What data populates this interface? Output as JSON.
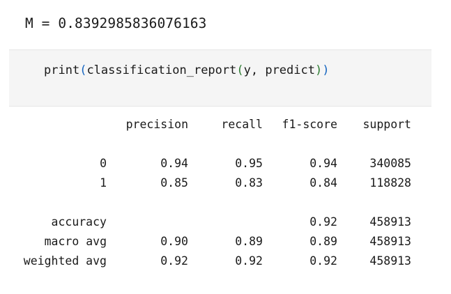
{
  "output": {
    "text": "M = 0.8392985836076163"
  },
  "code_cell": {
    "func": "print",
    "open1": "(",
    "inner_func": "classification_report",
    "open2": "(",
    "args": "y, predict",
    "close2": ")",
    "close1": ")"
  },
  "report": {
    "headers": {
      "precision": "precision",
      "recall": "recall",
      "f1": "f1-score",
      "support": "support"
    },
    "rows": [
      {
        "label": "0",
        "precision": "0.94",
        "recall": "0.95",
        "f1": "0.94",
        "support": "340085"
      },
      {
        "label": "1",
        "precision": "0.85",
        "recall": "0.83",
        "f1": "0.84",
        "support": "118828"
      },
      {
        "label": "accuracy",
        "precision": "",
        "recall": "",
        "f1": "0.92",
        "support": "458913"
      },
      {
        "label": "macro avg",
        "precision": "0.90",
        "recall": "0.89",
        "f1": "0.89",
        "support": "458913"
      },
      {
        "label": "weighted avg",
        "precision": "0.92",
        "recall": "0.92",
        "f1": "0.92",
        "support": "458913"
      }
    ]
  }
}
